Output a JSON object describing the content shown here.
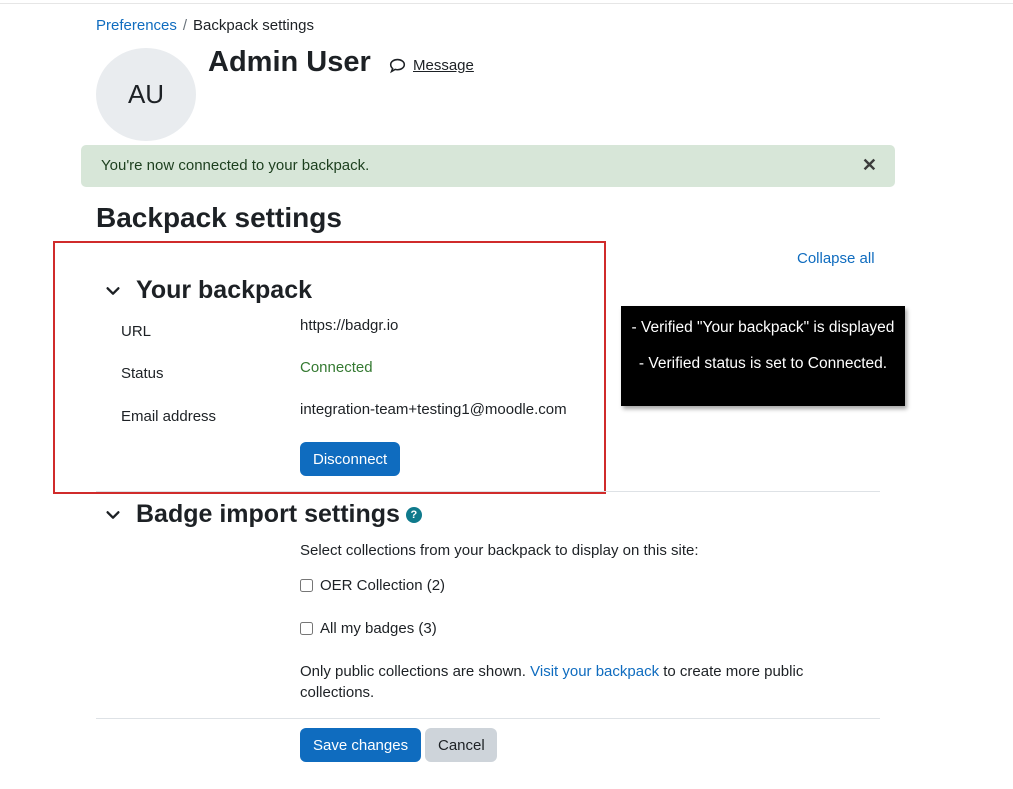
{
  "breadcrumb": {
    "parent": "Preferences",
    "separator": "/",
    "current": "Backpack settings"
  },
  "user": {
    "initials": "AU",
    "name": "Admin User",
    "message_label": "Message"
  },
  "alert": {
    "text": "You're now connected to your backpack.",
    "close": "✕"
  },
  "page": {
    "title": "Backpack settings",
    "collapse_all": "Collapse all"
  },
  "your_backpack": {
    "heading": "Your backpack",
    "fields": [
      {
        "label": "URL",
        "value": "https://badgr.io"
      },
      {
        "label": "Status",
        "value": "Connected"
      },
      {
        "label": "Email address",
        "value": "integration-team+testing1@moodle.com"
      }
    ],
    "disconnect_label": "Disconnect"
  },
  "annotation": {
    "line1": "- Verified \"Your backpack\" is displayed",
    "line2": "- Verified status is set to Connected."
  },
  "badge_import": {
    "heading": "Badge import settings",
    "help_glyph": "?",
    "instruction": "Select collections from your backpack to display on this site:",
    "collections": [
      {
        "label": "OER Collection (2)",
        "checked": false
      },
      {
        "label": "All my badges (3)",
        "checked": false
      }
    ],
    "info_prefix": "Only public collections are shown.",
    "info_link": "Visit your backpack",
    "info_suffix": "to create more public collections."
  },
  "actions": {
    "save": "Save changes",
    "cancel": "Cancel"
  },
  "colors": {
    "primary": "#0f6cbf",
    "success_text": "#357a32",
    "alert_bg": "#d7e6d8",
    "highlight_border": "#d02b2b"
  }
}
